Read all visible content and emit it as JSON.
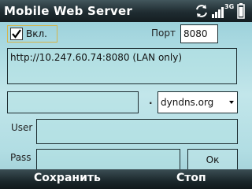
{
  "titlebar": {
    "title": "Mobile Web Server",
    "status_icons": [
      "sync-icon",
      "signal-3g-icon",
      "battery-icon"
    ],
    "network_type": "3G"
  },
  "form": {
    "enabled_checked": true,
    "enabled_label": "Вкл.",
    "port_label": "Порт",
    "port_value": "8080",
    "url_text": "http://10.247.60.74:8080 (LAN only)",
    "hostname_value": "",
    "dot_separator": ".",
    "domain_selected": "dyndns.org",
    "user_label": "User",
    "user_value": "",
    "pass_label": "Pass",
    "pass_value": "",
    "ok_label": "Ок"
  },
  "softkeys": {
    "left": "Сохранить",
    "right": "Стоп"
  },
  "colors": {
    "titlebar_bg": "#1f2c31",
    "background": "#b1dde3",
    "focus_border": "#d4b54b"
  }
}
